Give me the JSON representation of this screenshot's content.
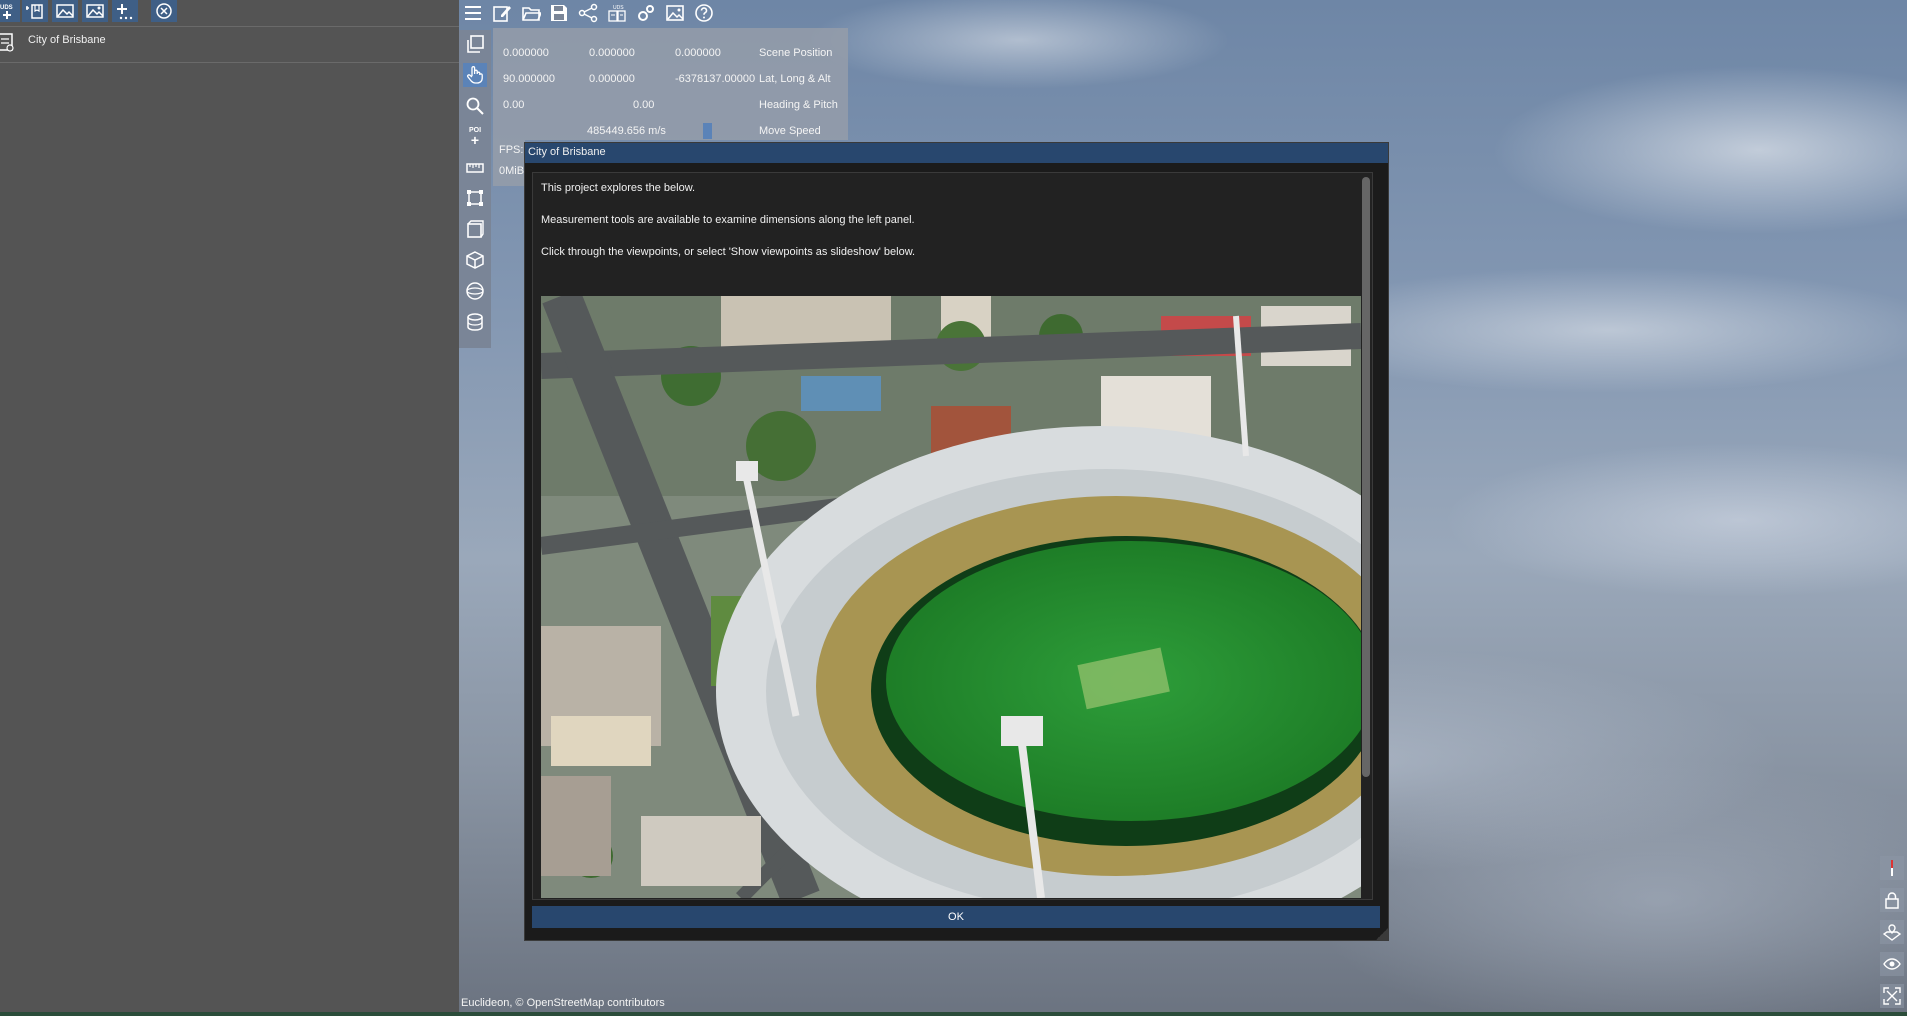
{
  "left_panel": {
    "scene_item": {
      "label": "City of Brisbane"
    }
  },
  "camera": {
    "scene_position": {
      "x": "0.000000",
      "y": "0.000000",
      "z": "0.000000",
      "label": "Scene Position"
    },
    "lat_long_alt": {
      "lat": "90.000000",
      "long": "0.000000",
      "alt": "-6378137.00000",
      "label": "Lat, Long & Alt"
    },
    "heading_pitch": {
      "heading": "0.00",
      "pitch": "0.00",
      "label": "Heading & Pitch"
    },
    "move_speed": {
      "value": "485449.656 m/s",
      "label": "Move Speed"
    }
  },
  "stats": {
    "fps_label": "FPS:",
    "mem_label": "0MiB"
  },
  "modal": {
    "title": "City of Brisbane",
    "line1": "This project explores the below.",
    "line2": "Measurement tools are available to examine dimensions along the left panel.",
    "line3": "Click through the viewpoints, or select 'Show viewpoints as slideshow' below.",
    "ok_label": "OK"
  },
  "attribution": "Euclideon, © OpenStreetMap contributors",
  "icons": {
    "left_toolbar": [
      "add-uds-icon",
      "add-folder-icon",
      "add-image-icon",
      "add-photo-icon",
      "add-more-icon",
      "close-circle-icon"
    ],
    "top_toolbar": [
      "menu-icon",
      "edit-icon",
      "open-folder-icon",
      "save-icon",
      "share-icon",
      "convert-icon",
      "settings-icon",
      "image-icon",
      "help-icon"
    ],
    "vertical_tools": [
      "copy-icon",
      "hand-select-icon",
      "search-icon",
      "poi-add-icon",
      "ruler-icon",
      "polygon-icon",
      "box-icon",
      "cube-icon",
      "sphere-icon",
      "cylinder-icon"
    ],
    "right_tools": [
      "compass-icon",
      "lock-icon",
      "map-pin-icon",
      "eye-icon",
      "fullscreen-icon"
    ]
  },
  "colors": {
    "accent": "#5b83b8",
    "title_bar": "#28476e",
    "panel": "#545454"
  }
}
